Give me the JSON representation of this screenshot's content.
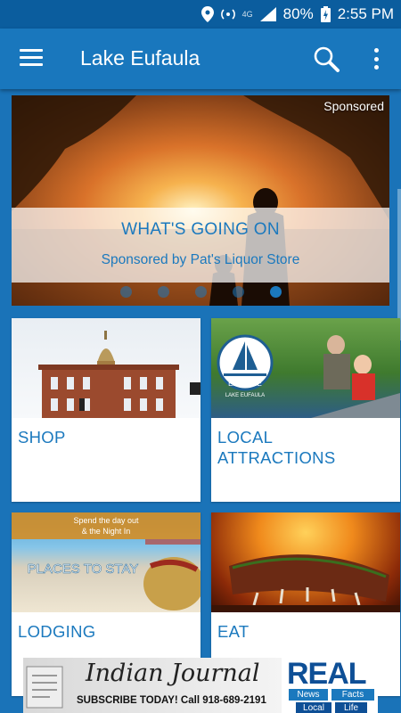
{
  "status_bar": {
    "battery": "80%",
    "time": "2:55 PM",
    "network": "4G"
  },
  "app_bar": {
    "title": "Lake Eufaula",
    "menu_icon": "hamburger-menu-icon",
    "search_icon": "search-icon",
    "more_icon": "more-vert-icon"
  },
  "hero": {
    "sponsored_tag": "Sponsored",
    "title": "WHAT'S GOING ON",
    "subtitle": "Sponsored by Pat's Liquor Store",
    "slide_count": 5,
    "active_slide": 5
  },
  "tiles": [
    {
      "label": "SHOP"
    },
    {
      "label": "LOCAL ATTRACTIONS",
      "logo_text": "LAKE EUFAULA",
      "logo_word": "EXPLORE"
    },
    {
      "label": "LODGING",
      "image_text_1": "Spend the day out",
      "image_text_2": "& the Night In",
      "image_text_3": "PLACES TO STAY"
    },
    {
      "label": "EAT"
    }
  ],
  "ad": {
    "title": "Indian Journal",
    "line": "SUBSCRIBE TODAY! Call 918-689-2191",
    "brand": "REAL",
    "chips": [
      "News",
      "Facts",
      "Local",
      "Life"
    ]
  },
  "colors": {
    "primary": "#1977bd",
    "status_bar": "#0b5d9e",
    "accent_text": "#1b79be",
    "background": "#1a73b8"
  }
}
